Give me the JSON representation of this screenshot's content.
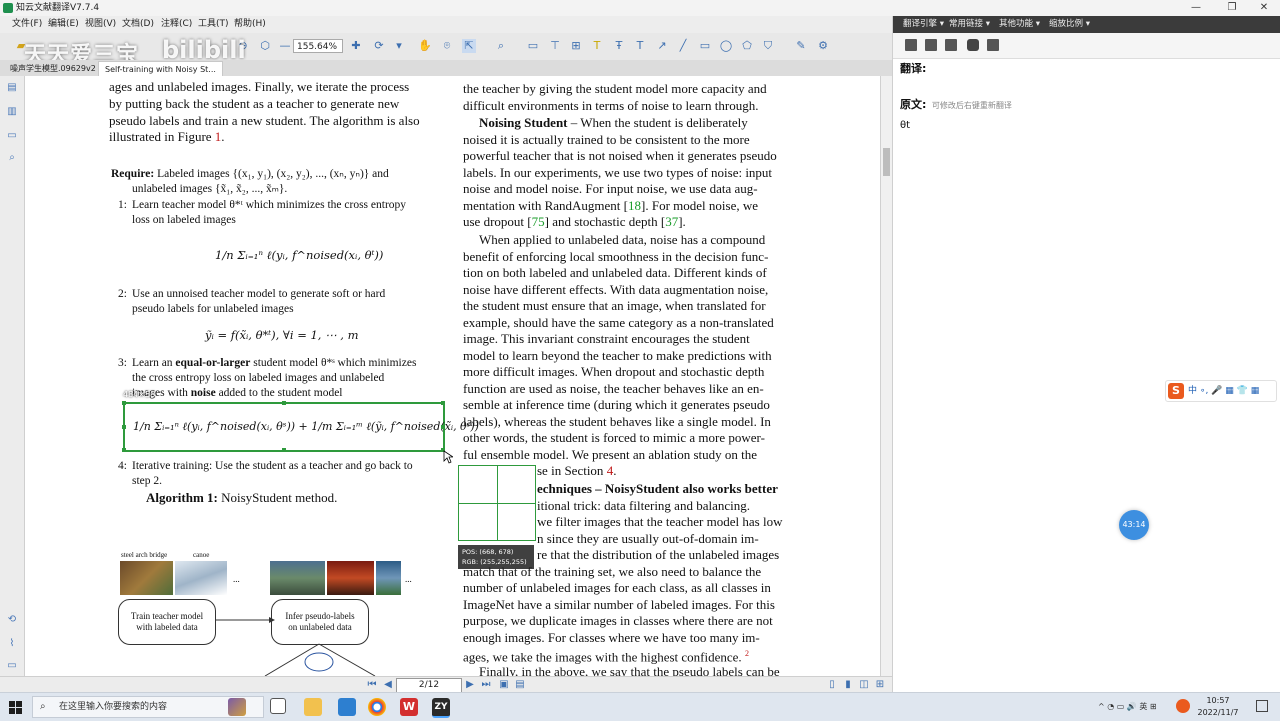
{
  "window": {
    "title": "知云文献翻译V7.7.4",
    "min": "—",
    "max": "❐",
    "close": "✕"
  },
  "menu": [
    "文件(F)",
    "编辑(E)",
    "视图(V)",
    "文档(D)",
    "注释(C)",
    "工具(T)",
    "帮助(H)"
  ],
  "toolbar": {
    "zoom": "155.64%"
  },
  "watermark": {
    "left": "天天爱三宝",
    "right": "bilibili"
  },
  "tabs": [
    "噪声学生模型.09629v2",
    "Self-training with Noisy St..."
  ],
  "doc": {
    "left": {
      "l1": "ages and unlabeled images.  Finally, we iterate the process",
      "l2": "by putting back the student as a teacher to generate new",
      "l3": "pseudo labels and train a new student. The algorithm is also",
      "l4a": "illustrated in Figure ",
      "l4b": "1",
      "l4c": ".",
      "req_bold": "Require:",
      "req1": "Labeled images {(x₁, y₁), (x₂, y₂), ..., (xₙ, yₙ)} and",
      "req2": "unlabeled images {x̃₁, x̃₂, ..., x̃ₘ}.",
      "s1a": "1:",
      "s1b": "Learn teacher model θ*ᵗ which minimizes the cross entropy",
      "s1c": "loss on labeled images",
      "eq1": "1/n Σᵢ₌₁ⁿ ℓ(yᵢ, f^noised(xᵢ, θᵗ))",
      "s2a": "2:",
      "s2b": "Use an unnoised teacher model to generate soft or hard",
      "s2c": "pseudo labels for unlabeled images",
      "eq2": "ỹᵢ = f(x̃ᵢ, θ*ᵗ), ∀i = 1, ⋯ , m",
      "s3a": "3:",
      "s3b1": "Learn an ",
      "s3b2": "equal-or-larger",
      "s3b3": " student model θ*ˢ which minimizes",
      "s3c": "the cross entropy loss on labeled images and unlabeled",
      "s3d1": "images with ",
      "s3d2": "noise",
      "s3d3": " added to the student model",
      "sel_size": "484×58",
      "eq3": "1/n Σᵢ₌₁ⁿ ℓ(yᵢ, f^noised(xᵢ, θˢ)) + 1/m Σᵢ₌₁ᵐ ℓ(ỹᵢ, f^noised(x̃ᵢ, θˢ))",
      "s4a": "4:",
      "s4b": "Iterative training: Use the student as a teacher and go back to",
      "s4c": "step 2.",
      "alg_bold": "Algorithm 1:",
      "alg_rest": " NoisyStudent method.",
      "fig_lbl1": "steel arch bridge",
      "fig_lbl2": "canoe",
      "fig_dots1": "...",
      "fig_dots2": "...",
      "fig_box1": "Train teacher model\nwith labeled data",
      "fig_box2": "Infer pseudo-labels\non unlabeled data"
    },
    "right": {
      "r1": "the teacher by giving the student model more capacity and",
      "r2": "difficult environments in terms of noise to learn through.",
      "ns_bold": "Noising Student",
      "ns_rest": " – When the student is deliberately",
      "r4": "noised it is actually trained to be consistent to the more",
      "r5": "powerful teacher that is not noised when it generates pseudo",
      "r6": "labels. In our experiments, we use two types of noise: input",
      "r7": "noise and model noise.  For input noise, we use data aug-",
      "r8a": "mentation with RandAugment [",
      "r8b": "18",
      "r8c": "].  For model noise, we",
      "r9a": "use dropout [",
      "r9b": "75",
      "r9c": "] and stochastic depth [",
      "r9d": "37",
      "r9e": "].",
      "p2_1": "When applied to unlabeled data, noise has a compound",
      "p2_2": "benefit of enforcing local smoothness in the decision func-",
      "p2_3": "tion on both labeled and unlabeled data. Different kinds of",
      "p2_4": "noise have different effects. With data augmentation noise,",
      "p2_5": "the student must ensure that an image, when translated for",
      "p2_6": "example, should have the same category as a non-translated",
      "p2_7": "image.  This invariant constraint encourages the student",
      "p2_8": "model to learn beyond the teacher to make predictions with",
      "p2_9": "more difficult images.  When dropout and stochastic depth",
      "p2_10": "function are used as noise, the teacher behaves like an en-",
      "p2_11": "semble at inference time (during which it generates pseudo",
      "p2_12": "labels), whereas the student behaves like a single model. In",
      "p2_13": "other words, the student is forced to mimic a more power-",
      "p2_14": "ful ensemble model.  We present an ablation study on the",
      "p2_15a": "se in Section ",
      "p2_15b": "4",
      "p2_15c": ".",
      "p3_1": "echniques – NoisyStudent also works better",
      "p3_2": "itional trick:  data filtering and balancing.",
      "p3_3": "we filter images that the teacher model has low",
      "p3_4": "n since they are usually out-of-domain im-",
      "p3_5": "re that the distribution of the unlabeled images",
      "p3_6": "match that of the training set, we also need to balance the",
      "p3_7": "number of unlabeled images for each class, as all classes in",
      "p3_8": "ImageNet have a similar number of labeled images. For this",
      "p3_9": "purpose, we duplicate images in classes where there are not",
      "p3_10": "enough images.  For classes where we have too many im-",
      "p3_11a": "ages, we take the images with the highest confidence.",
      "p3_11b": "2",
      "p3_12": "Finally, in the above, we say that the pseudo labels can be"
    },
    "pixel_tip": {
      "pos": "POS:  (668, 678)",
      "rgb": "RGB:  (255,255,255)"
    }
  },
  "status": {
    "page": "2/12"
  },
  "panel": {
    "menu": [
      "翻译引擎 ▾",
      "常用链接 ▾",
      "其他功能 ▾",
      "缩放比例 ▾"
    ],
    "translation_label": "翻译:",
    "source_label": "原文:",
    "source_hint": "可修改后右键重新翻译",
    "source_text": "θt",
    "ime": "中  ∘,  🎤  ▦  👕  ▦",
    "timer": "43:14"
  },
  "taskbar": {
    "search_placeholder": "在这里输入你要搜索的内容",
    "time": "10:57",
    "date": "2022/11/7",
    "tray": "^  ◔  ▭  🔊  英  ⊞"
  }
}
